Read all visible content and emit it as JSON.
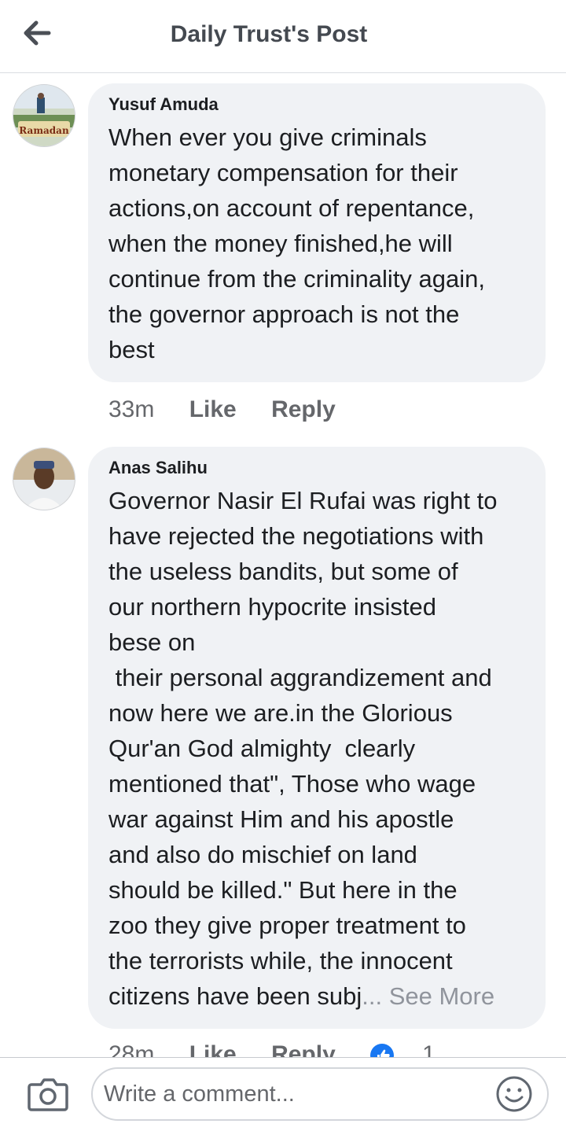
{
  "header": {
    "title": "Daily Trust's Post",
    "back_icon": "arrow-left-icon"
  },
  "comments": [
    {
      "author": "Yusuf Amuda",
      "avatar_label": "Ramadan",
      "text": "When ever you give criminals\nmonetary compensation for their\nactions,on account of repentance,\nwhen the money finished,he will\ncontinue from the criminality again,\nthe governor approach is not the\nbest",
      "time": "33m",
      "like": "Like",
      "reply": "Reply"
    },
    {
      "author": "Anas Salihu",
      "text": "Governor Nasir El Rufai was right to\nhave rejected the negotiations with\nthe useless bandits, but some of\nour northern hypocrite insisted\nbese on\n their personal aggrandizement and\nnow here we are.in the Glorious\nQur'an God almighty  clearly\nmentioned that\", Those who wage\nwar against Him and his apostle\nand also do mischief on land\nshould be killed.\" But here in the\nzoo they give proper treatment to\nthe terrorists while, the innocent\ncitizens have been subj",
      "see_more": "... See More",
      "time": "28m",
      "like": "Like",
      "reply": "Reply",
      "reaction_count": "1",
      "reaction_icon": "thumbs-up-icon"
    }
  ],
  "composer": {
    "placeholder": "Write a comment...",
    "camera_icon": "camera-icon",
    "emoji_icon": "smiley-icon"
  },
  "colors": {
    "bubble": "#f0f2f5",
    "reaction": "#1877f2",
    "muted": "#65676b"
  }
}
